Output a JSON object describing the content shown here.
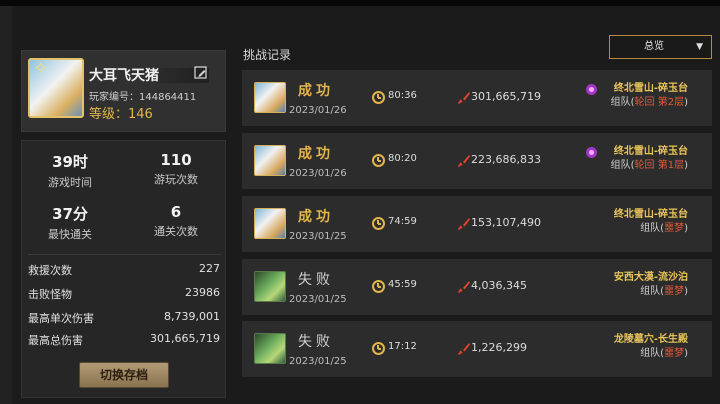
{
  "profile": {
    "name": "大耳飞天猪",
    "player_id": "玩家编号：144864411",
    "level": "等级：146"
  },
  "stats": [
    {
      "value": "39时",
      "label": "游戏时间"
    },
    {
      "value": "110",
      "label": "游玩次数"
    },
    {
      "value": "37分",
      "label": "最快通关"
    },
    {
      "value": "6",
      "label": "通关次数"
    }
  ],
  "details": [
    {
      "label": "救援次数",
      "value": "227"
    },
    {
      "label": "击败怪物",
      "value": "23986"
    },
    {
      "label": "最高单次伤害",
      "value": "8,739,001"
    },
    {
      "label": "最高总伤害",
      "value": "301,665,719"
    }
  ],
  "switch_save_label": "切换存档",
  "records_title": "挑战记录",
  "filter": {
    "selected": "总览"
  },
  "records": [
    {
      "result": "成功",
      "date": "2023/01/26",
      "time": "80:36",
      "damage": "301,665,719",
      "stage": "终北雪山-碎玉台",
      "team": "组队(",
      "tag": "轮回 第2层",
      "team_end": ")",
      "outcome": "win",
      "avatar": "pig",
      "boss": true
    },
    {
      "result": "成功",
      "date": "2023/01/26",
      "time": "80:20",
      "damage": "223,686,833",
      "stage": "终北雪山-碎玉台",
      "team": "组队(",
      "tag": "轮回 第1层",
      "team_end": ")",
      "outcome": "win",
      "avatar": "pig",
      "boss": true
    },
    {
      "result": "成功",
      "date": "2023/01/25",
      "time": "74:59",
      "damage": "153,107,490",
      "stage": "终北雪山-碎玉台",
      "team": "组队(",
      "tag": "噩梦",
      "team_end": ")",
      "outcome": "win",
      "avatar": "pig",
      "boss": false
    },
    {
      "result": "失败",
      "date": "2023/01/25",
      "time": "45:59",
      "damage": "4,036,345",
      "stage": "安西大漠-流沙泊",
      "team": "组队(",
      "tag": "噩梦",
      "team_end": ")",
      "outcome": "lose",
      "avatar": "dragon",
      "boss": false
    },
    {
      "result": "失败",
      "date": "2023/01/25",
      "time": "17:12",
      "damage": "1,226,299",
      "stage": "龙陵墓穴-长生殿",
      "team": "组队(",
      "tag": "噩梦",
      "team_end": ")",
      "outcome": "lose",
      "avatar": "dragon",
      "boss": false
    }
  ]
}
